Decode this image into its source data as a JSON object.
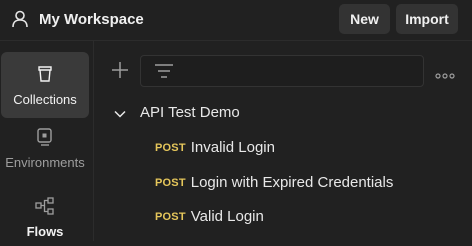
{
  "header": {
    "workspace_title": "My Workspace",
    "new_label": "New",
    "import_label": "Import",
    "workspace_icon": "user-icon"
  },
  "sidebar": {
    "items": [
      {
        "label": "Collections",
        "icon": "trash-bin-icon",
        "active": true
      },
      {
        "label": "Environments",
        "icon": "environment-icon",
        "active": false
      },
      {
        "label": "Flows",
        "icon": "flows-icon",
        "active": false
      }
    ]
  },
  "toolbar": {
    "add_icon": "plus-icon",
    "filter_icon": "filter-icon",
    "more_icon": "more-icon"
  },
  "collection": {
    "name": "API Test Demo",
    "expanded": true,
    "requests": [
      {
        "method": "POST",
        "name": "Invalid Login"
      },
      {
        "method": "POST",
        "name": "Login with Expired Credentials"
      },
      {
        "method": "POST",
        "name": "Valid Login"
      }
    ]
  },
  "colors": {
    "background": "#212121",
    "active_sidebar": "#3a3a3a",
    "button_bg": "#333333",
    "method_post": "#e6c75b"
  }
}
